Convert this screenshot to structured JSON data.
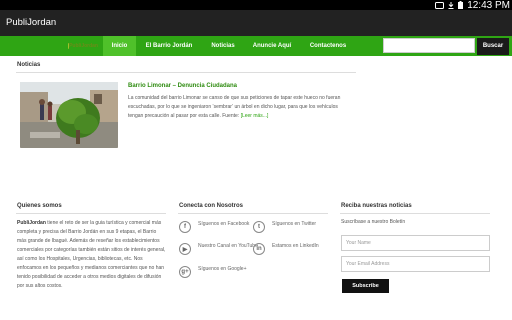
{
  "status": {
    "time": "12:43 PM",
    "icons": [
      "tablet-icon",
      "download-icon",
      "battery-icon"
    ]
  },
  "app": {
    "title": "PubliJordan"
  },
  "logo": {
    "text": "PubliJordan"
  },
  "nav": {
    "items": [
      {
        "label": "Inicio",
        "active": true
      },
      {
        "label": "El Barrio Jordán",
        "active": false
      },
      {
        "label": "Noticias",
        "active": false
      },
      {
        "label": "Anuncie Aquí",
        "active": false
      },
      {
        "label": "Contactenos",
        "active": false
      }
    ],
    "search_button": "Buscar"
  },
  "news": {
    "heading": "Noticias",
    "item": {
      "title": "Barrio Limonar – Denuncia Ciudadana",
      "text": "La comunidad del barrio Limonar se canso de que sus peticiones de tapar este hueco no fueran escuchadas, por lo que se ingeniaron ‘sembrar’ un árbol en dicho lugar, para que los vehículos tengan precaución al pasar por esta calle. Fuente:",
      "more": "[Leer más...]"
    }
  },
  "footer": {
    "about": {
      "heading": "Quienes somos",
      "brand": "PubliJordan",
      "text": " tiene el reto de ser la guia turística y comercial más completa y precisa del Barrio Jordán en sus 9 etapas, el Barrio más grande de Ibagué. Además de reseñar los establecimientos comerciales por categorías también están sitios de interés general, así como los Hospitales, Urgencias, bibliotecas, etc. Nos enfocamos en los pequeños y medianos comerciantes que no han tenido posibilidad de acceder a otros medios digitales de difusión por sus altos costos."
    },
    "connect": {
      "heading": "Conecta con Nosotros",
      "facebook": "Síguenos en Facebook",
      "twitter": "Síguenos en Twitter",
      "youtube": "Nuestro Canal en YouTube",
      "linkedin": "Estamos en LinkedIn",
      "google": "Síguenos en Google+"
    },
    "newsletter": {
      "heading": "Reciba nuestras noticias",
      "subtitle": "Suscríbase a nuestro Boletín",
      "name_placeholder": "Your Name",
      "email_placeholder": "Your Email Address",
      "button": "Subscribe"
    }
  },
  "colors": {
    "nav": "#2fa514",
    "nav_active": "#4fc12a",
    "appbar": "#222222",
    "accent_text": "#2f8c11"
  }
}
